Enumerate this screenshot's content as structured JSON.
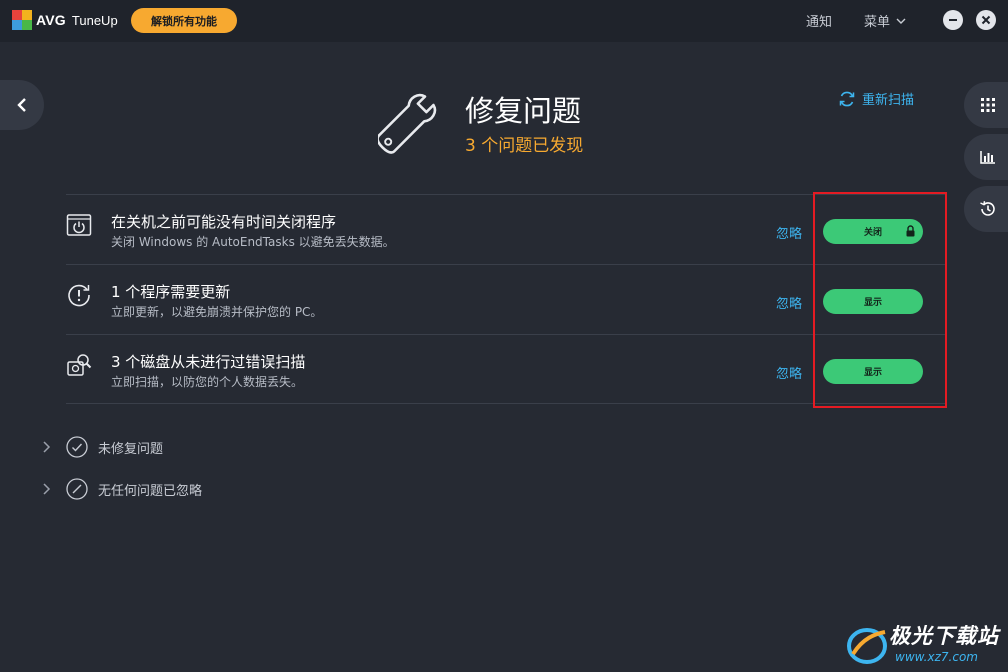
{
  "titlebar": {
    "brand": "AVG",
    "product": "TuneUp",
    "unlock_label": "解锁所有功能",
    "notify_label": "通知",
    "menu_label": "菜单"
  },
  "header": {
    "title": "修复问题",
    "subtitle": "3 个问题已发现",
    "rescan_label": "重新扫描"
  },
  "issues": [
    {
      "title": "在关机之前可能没有时间关闭程序",
      "description": "关闭 Windows 的 AutoEndTasks 以避免丢失数据。",
      "ignore_label": "忽略",
      "action_label": "关闭",
      "icon": "shutdown-timer-icon",
      "locked": true
    },
    {
      "title": "1 个程序需要更新",
      "description": "立即更新，以避免崩溃并保护您的 PC。",
      "ignore_label": "忽略",
      "action_label": "显示",
      "icon": "update-alert-icon",
      "locked": false
    },
    {
      "title": "3 个磁盘从未进行过错误扫描",
      "description": "立即扫描，以防您的个人数据丢失。",
      "ignore_label": "忽略",
      "action_label": "显示",
      "icon": "disk-scan-icon",
      "locked": false
    }
  ],
  "sections": {
    "unfixed_label": "未修复问题",
    "ignored_label": "无任何问题已忽略"
  },
  "watermark": {
    "text": "极光下载站",
    "url": "www.xz7.com"
  },
  "colors": {
    "background": "#262a33",
    "titlebar": "#1f232b",
    "accent_orange": "#f7a930",
    "accent_blue": "#3db5f0",
    "action_green": "#3cc977",
    "highlight_red": "#e41b23"
  }
}
